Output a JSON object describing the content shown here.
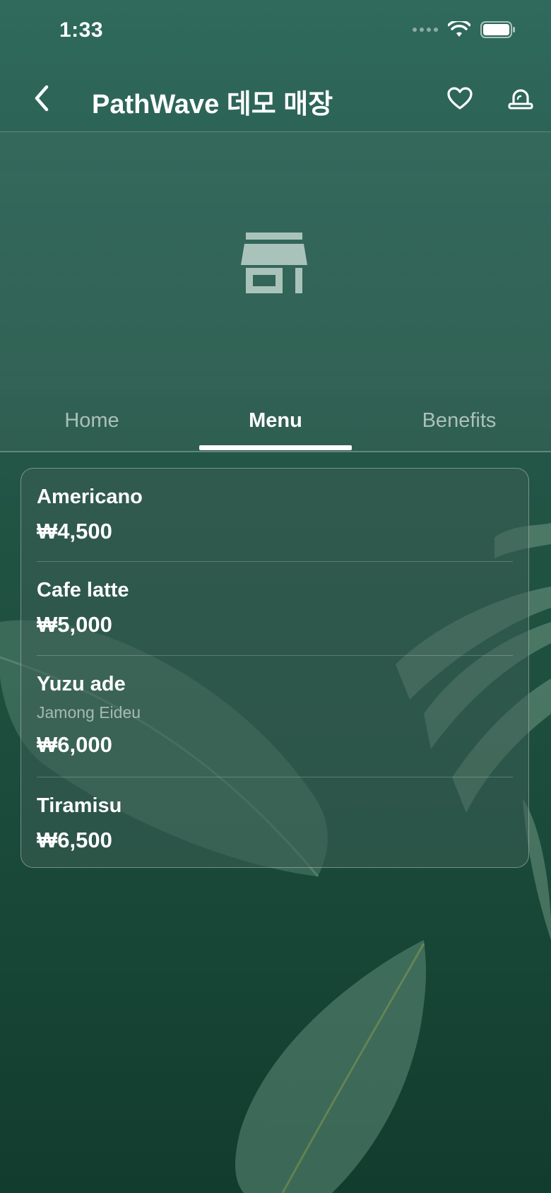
{
  "status_bar": {
    "time": "1:33"
  },
  "header": {
    "title": "PathWave 데모 매장"
  },
  "tabs": [
    {
      "label": "Home",
      "active": false
    },
    {
      "label": "Menu",
      "active": true
    },
    {
      "label": "Benefits",
      "active": false
    }
  ],
  "menu": {
    "items": [
      {
        "name": "Americano",
        "subtitle": "",
        "price": "₩4,500"
      },
      {
        "name": "Cafe latte",
        "subtitle": "",
        "price": "₩5,000"
      },
      {
        "name": "Yuzu ade",
        "subtitle": "Jamong Eideu",
        "price": "₩6,000"
      },
      {
        "name": "Tiramisu",
        "subtitle": "",
        "price": "₩6,500"
      }
    ]
  },
  "icons": {
    "back": "chevron-left-icon",
    "favorite": "heart-icon",
    "alert": "siren-icon",
    "store": "store-icon"
  },
  "colors": {
    "background_top": "#2f6a5c",
    "background_bottom": "#123c2e",
    "text": "#ffffff"
  }
}
